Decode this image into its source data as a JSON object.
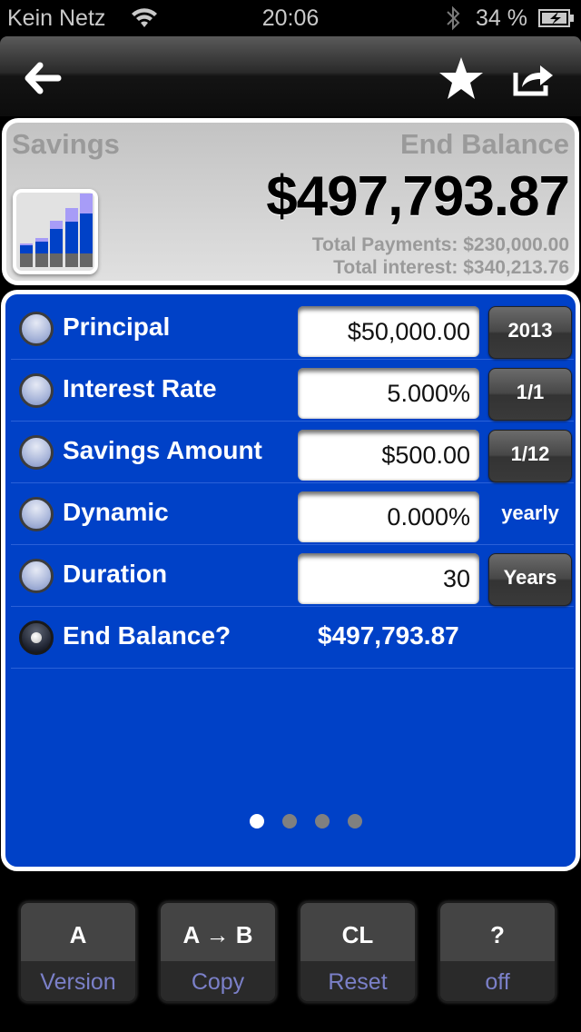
{
  "status_bar": {
    "carrier": "Kein Netz",
    "time": "20:06",
    "battery_percent": "34 %",
    "icons": [
      "wifi-icon",
      "bluetooth-icon",
      "battery-charging-icon"
    ]
  },
  "navbar": {
    "icons": {
      "back": "arrow-left-icon",
      "favorite": "star-icon",
      "share": "share-icon"
    }
  },
  "summary": {
    "title": "Savings",
    "result_label": "End Balance",
    "result_value": "$497,793.87",
    "total_payments": "Total Payments: $230,000.00",
    "total_interest": "Total interest: $340,213.76",
    "chart_icon": "bar-chart-icon",
    "colors": {
      "principal": "#666666",
      "payments": "#0041c7",
      "interest": "#a79cf7"
    }
  },
  "calculator": {
    "background_color": "#0041c7",
    "rows": [
      {
        "label": "Principal",
        "value": "$50,000.00",
        "side": "2013",
        "side_type": "button",
        "selected": false
      },
      {
        "label": "Interest Rate",
        "value": "5.000%",
        "side": "1/1",
        "side_type": "button",
        "selected": false
      },
      {
        "label": "Savings Amount",
        "value": "$500.00",
        "side": "1/12",
        "side_type": "button",
        "selected": false
      },
      {
        "label": "Dynamic",
        "value": "0.000%",
        "side": "yearly",
        "side_type": "text",
        "selected": false
      },
      {
        "label": "Duration",
        "value": "30",
        "side": "Years",
        "side_type": "button",
        "selected": false
      },
      {
        "label": "End Balance?",
        "value": "$497,793.87",
        "side": "",
        "side_type": "none",
        "selected": true
      }
    ],
    "page_indicator": {
      "pages": 4,
      "current": 1
    }
  },
  "bottom_buttons": [
    {
      "top": "A",
      "sub": "Version"
    },
    {
      "top": "A → B",
      "sub": "Copy"
    },
    {
      "top": "CL",
      "sub": "Reset"
    },
    {
      "top": "?",
      "sub": "off"
    }
  ]
}
